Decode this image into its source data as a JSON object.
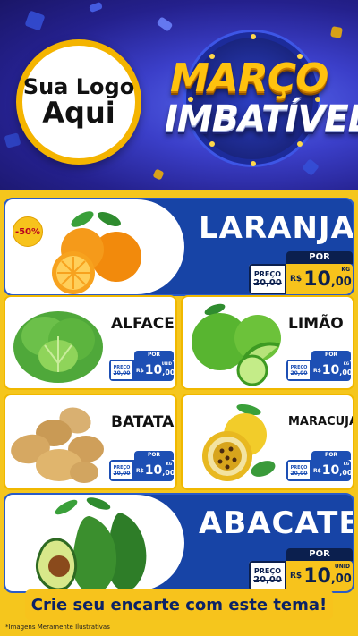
{
  "header": {
    "logo_line1": "Sua Logo",
    "logo_line2": "Aqui",
    "title_line1": "MARÇO",
    "title_line2": "IMBATÍVEL"
  },
  "currency": "R$",
  "old_label": "PREÇO",
  "por_label": "POR",
  "products": {
    "laranja": {
      "name": "LARANJA",
      "discount": "-50%",
      "old_price": "20,00",
      "price_int": "10",
      "price_dec": ",00",
      "unit": "KG"
    },
    "alface": {
      "name": "ALFACE",
      "old_price": "20,00",
      "price_int": "10",
      "price_dec": ",00",
      "unit": "UNID"
    },
    "limao": {
      "name": "LIMÃO",
      "old_price": "20,00",
      "price_int": "10",
      "price_dec": ",00",
      "unit": "KG"
    },
    "batata": {
      "name": "BATATA",
      "old_price": "20,00",
      "price_int": "10",
      "price_dec": ",00",
      "unit": "KG"
    },
    "maracuja": {
      "name": "MARACUJÁ",
      "old_price": "20,00",
      "price_int": "10",
      "price_dec": ",00",
      "unit": "KG"
    },
    "abacate": {
      "name": "ABACATE",
      "old_price": "20,00",
      "price_int": "10",
      "price_dec": ",00",
      "unit": "UNID"
    }
  },
  "cta": "Crie seu encarte com este tema!",
  "disclaimer": "*Imagens Meramente Ilustrativas",
  "colors": {
    "blue": "#1744a6",
    "yellow": "#f7c31c",
    "navy": "#0b1f4e"
  }
}
